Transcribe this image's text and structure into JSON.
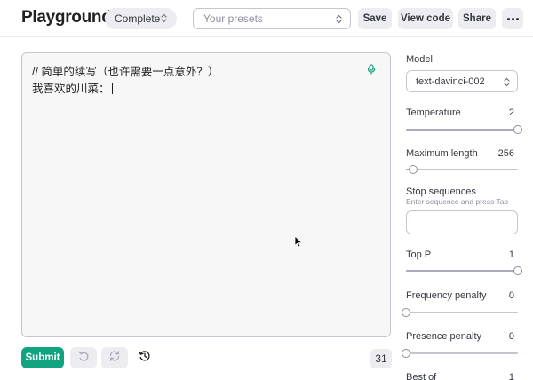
{
  "header": {
    "title": "Playground",
    "mode": "Complete",
    "presets_placeholder": "Your presets",
    "save_label": "Save",
    "view_code_label": "View code",
    "share_label": "Share"
  },
  "editor": {
    "line1": "// 简单的续写（也许需要一点意外？）",
    "line2": "我喜欢的川菜："
  },
  "footer": {
    "submit_label": "Submit",
    "token_count": "31"
  },
  "sidebar": {
    "model_label": "Model",
    "model_value": "text-davinci-002",
    "temperature": {
      "label": "Temperature",
      "value": "2",
      "fraction": 1.0
    },
    "max_length": {
      "label": "Maximum length",
      "value": "256",
      "fraction": 0.06
    },
    "stop": {
      "label": "Stop sequences",
      "hint": "Enter sequence and press Tab"
    },
    "top_p": {
      "label": "Top P",
      "value": "1",
      "fraction": 1.0
    },
    "frequency_penalty": {
      "label": "Frequency penalty",
      "value": "0",
      "fraction": 0.0
    },
    "presence_penalty": {
      "label": "Presence penalty",
      "value": "0",
      "fraction": 0.0
    },
    "best_of": {
      "label": "Best of",
      "value": "1"
    }
  },
  "colors": {
    "accent": "#10a37f",
    "button_bg": "#ececf1",
    "border": "#c5c5d2",
    "editor_bg": "#f7f7f8"
  }
}
